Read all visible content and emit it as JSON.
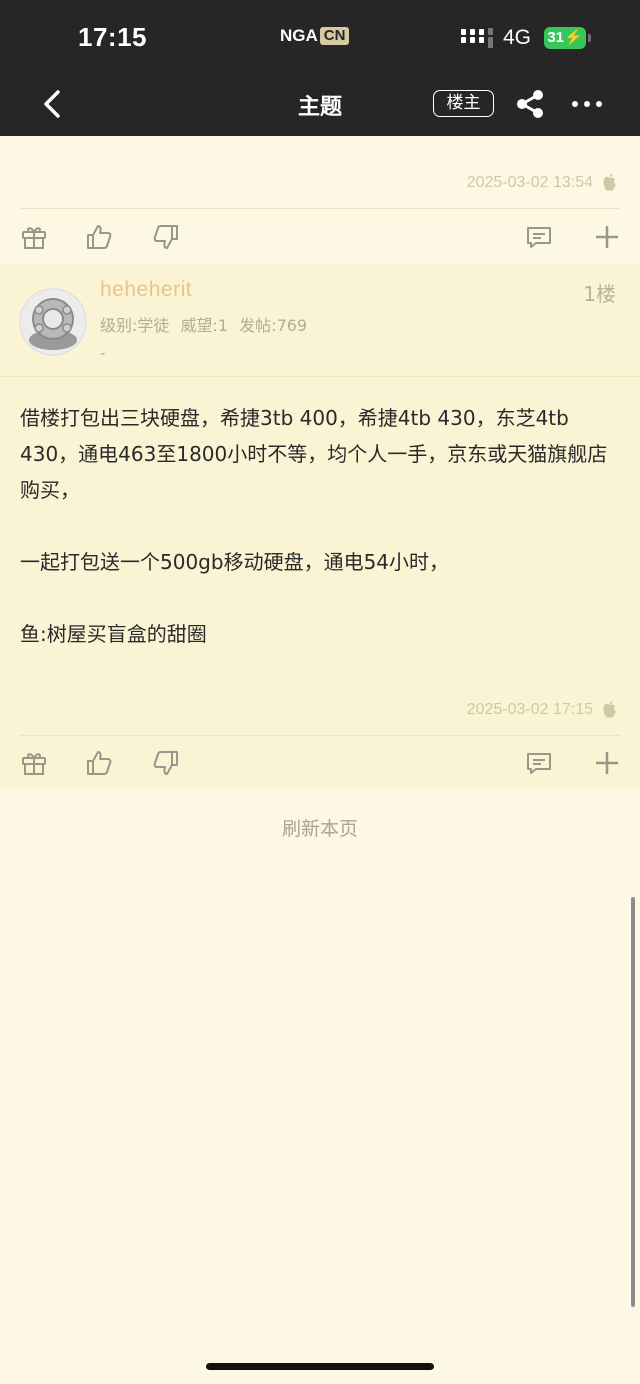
{
  "status_bar": {
    "time": "17:15",
    "app_logo_left": "NGA",
    "app_logo_right": "CN",
    "network": "4G",
    "battery": "31"
  },
  "nav": {
    "title": "主题",
    "op_filter_label": "楼主"
  },
  "posts": [
    {
      "timestamp": "2025-03-02 13:54"
    },
    {
      "username": "heheherit",
      "floor": "1楼",
      "level": "级别:学徒",
      "reputation": "威望:1",
      "post_count": "发帖:769",
      "signature": "-",
      "paragraphs": [
        "借楼打包出三块硬盘，希捷3tb 400，希捷4tb 430，东芝4tb 430，通电463至1800小时不等，均个人一手，京东或天猫旗舰店购买，",
        "一起打包送一个500gb移动硬盘，通电54小时，",
        "鱼:树屋买盲盒的甜圈"
      ],
      "timestamp": "2025-03-02 17:15"
    }
  ],
  "footer": {
    "refresh_label": "刷新本页"
  },
  "colors": {
    "topbar_bg": "#262626",
    "page_bg": "#fdf8e3",
    "post_bg": "#fbf4d4",
    "username": "#e8c48c",
    "battery": "#35c759"
  },
  "icons": [
    "back-icon",
    "share-icon",
    "more-icon",
    "apple-icon",
    "gift-icon",
    "thumbs-up-icon",
    "thumbs-down-icon",
    "comment-icon",
    "plus-icon"
  ]
}
